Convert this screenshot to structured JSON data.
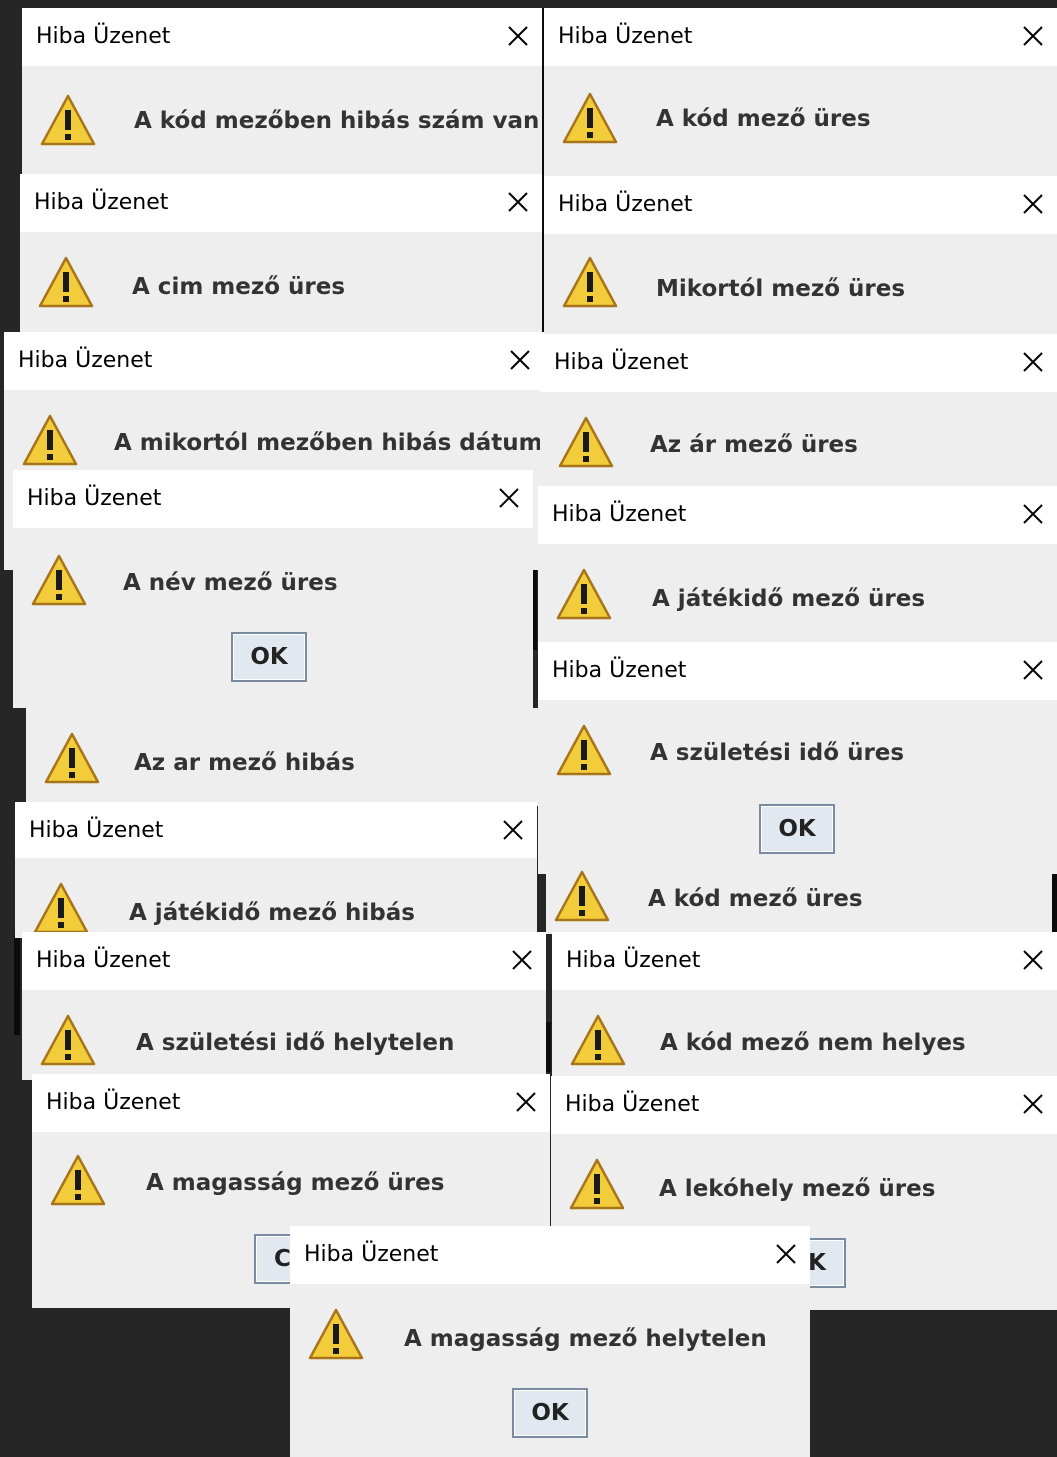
{
  "title": "Hiba Üzenet",
  "ok_label": "OK",
  "ok_partial_left": "C",
  "ok_partial_right": "K",
  "messages": [
    "A kód mezőben hibás szám van",
    "A kód mező üres",
    "A cim mező üres",
    "Mikortól mező üres",
    "A mikortól mezőben hibás dátum van",
    "Az ár mező üres",
    "A név mező üres",
    "A játékidő mező üres",
    "Az ar mező hibás",
    "A születési idő üres",
    "A játékidő mező hibás",
    "A kód mező üres",
    "A születési idő helytelen",
    "A kód mező nem helyes",
    "A magasság mező üres",
    "A lekóhely mező üres",
    "A magasság mező helytelen"
  ],
  "icons": {
    "warning": "warning-triangle-icon",
    "close": "close-x-icon"
  },
  "colors": {
    "background": "#262626",
    "titlebar": "#ffffff",
    "panel": "#eeeeee",
    "warning_fill": "#f2cc3a"
  }
}
